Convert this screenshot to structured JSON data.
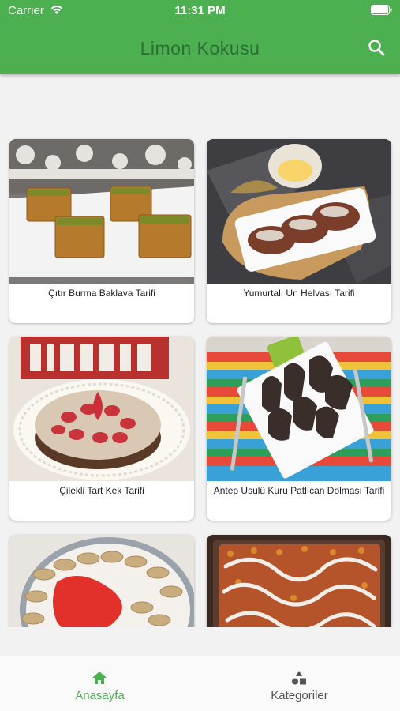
{
  "status_bar": {
    "carrier": "Carrier",
    "time": "11:31 PM"
  },
  "header": {
    "title": "Limon Kokusu",
    "search_icon": "search-icon"
  },
  "recipes": [
    {
      "title": "Çıtır Burma Baklava Tarifi"
    },
    {
      "title": "Yumurtalı Un Helvası Tarifi"
    },
    {
      "title": "Çilekli Tart Kek Tarifi"
    },
    {
      "title": "Antep Usulü Kuru Patlıcan Dolması Tarifi"
    },
    {
      "title": ""
    },
    {
      "title": ""
    }
  ],
  "tabs": [
    {
      "label": "Anasayfa",
      "icon": "home-icon",
      "active": true
    },
    {
      "label": "Kategoriler",
      "icon": "categories-icon",
      "active": false
    }
  ],
  "colors": {
    "primary": "#4caf50",
    "title_text": "#2e6d36",
    "active_tab": "#4caf50"
  }
}
